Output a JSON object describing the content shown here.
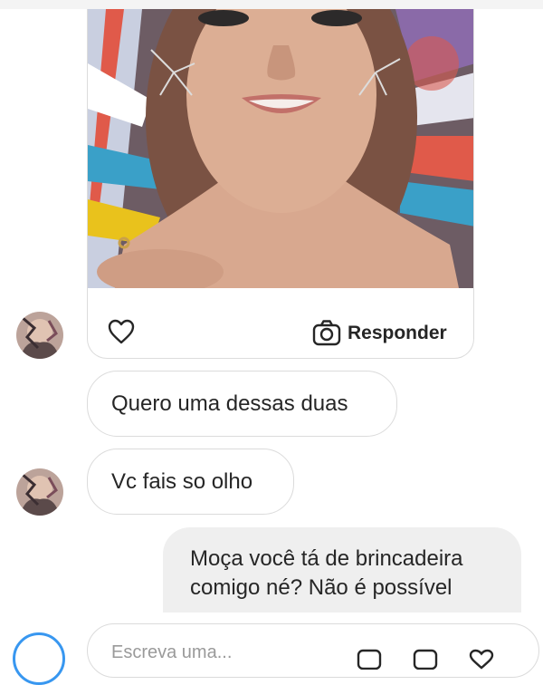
{
  "story_reply": {
    "reply_label": "Responder"
  },
  "messages": [
    {
      "direction": "incoming",
      "text": "Quero uma dessas duas"
    },
    {
      "direction": "incoming",
      "text": "Vc fais so olho"
    },
    {
      "direction": "outgoing",
      "line1": "Moça você tá de brincadeira",
      "line2": "comigo né? Não é possível"
    }
  ],
  "composer": {
    "placeholder": "Escreva uma..."
  },
  "icons": {
    "like": "heart-icon",
    "reply": "camera-icon",
    "composer_camera": "camera-icon",
    "mic": "microphone-icon",
    "gallery": "image-icon",
    "sticker": "sticker-icon"
  },
  "colors": {
    "accent": "#3897f0",
    "incoming_bubble_border": "#dbdbdb",
    "outgoing_bubble_bg": "#efefef",
    "text": "#262626"
  }
}
